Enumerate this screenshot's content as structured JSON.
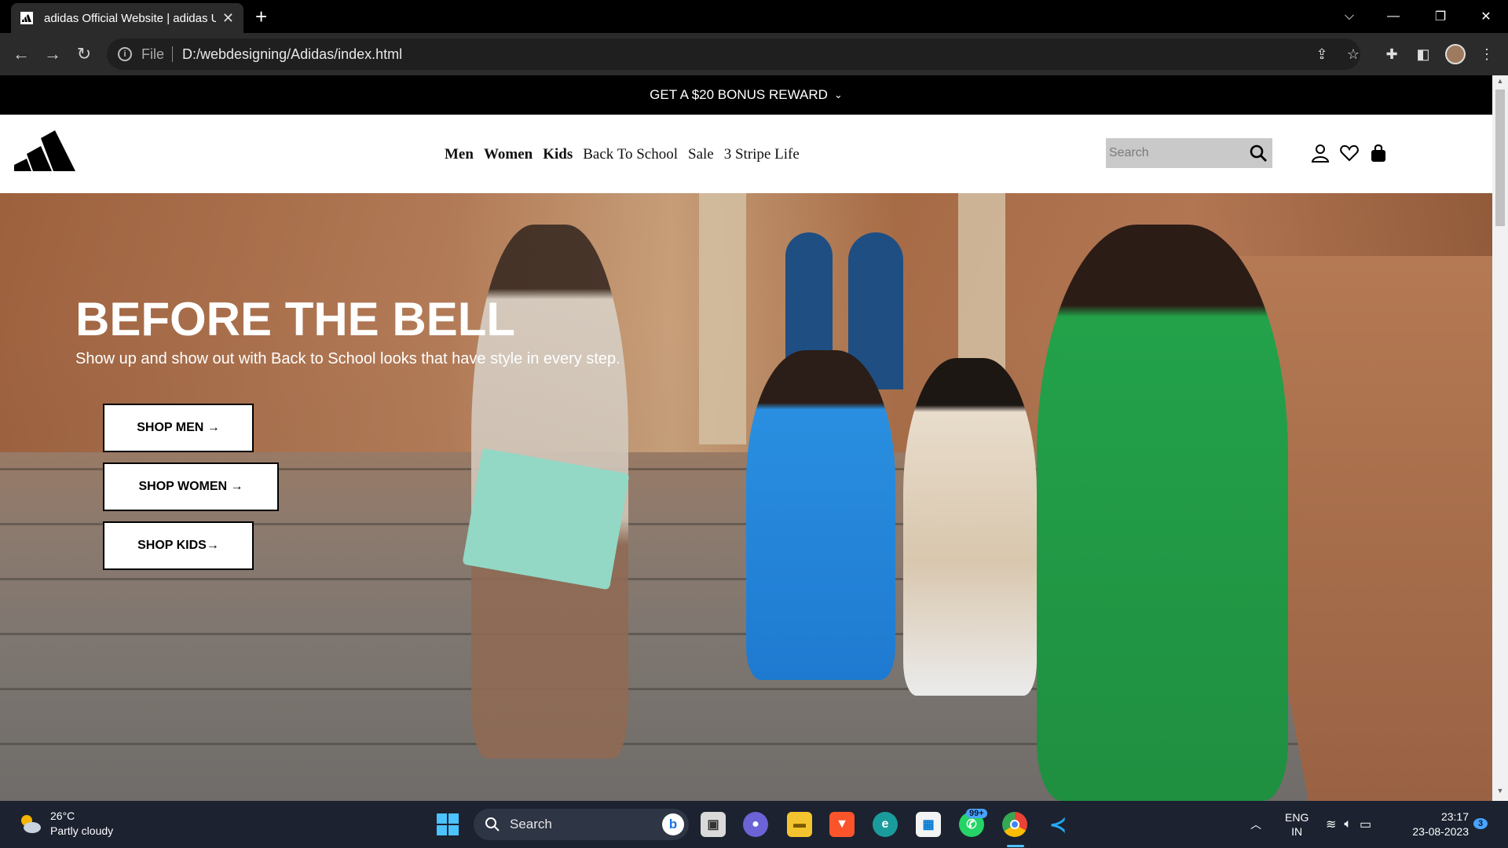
{
  "browser": {
    "tab_title": "adidas Official Website | adidas U",
    "tab_close": "✕",
    "new_tab": "+",
    "url_scheme": "File",
    "url": "D:/webdesigning/Adidas/index.html"
  },
  "promo": {
    "text": "GET A $20 BONUS REWARD"
  },
  "nav": {
    "men": "Men",
    "women": "Women",
    "kids": "Kids",
    "back_to_school": "Back To School",
    "sale": "Sale",
    "three_stripe": "3 Stripe Life"
  },
  "search": {
    "placeholder": "Search"
  },
  "hero": {
    "title": "BEFORE THE BELL",
    "subtitle": "Show up and show out with Back to School looks that have style in every step.",
    "buttons": {
      "men": "SHOP MEN →",
      "women": "SHOP WOMEN →",
      "kids": "SHOP KIDS→"
    }
  },
  "taskbar": {
    "temperature": "26°C",
    "condition": "Partly cloudy",
    "search_label": "Search",
    "whatsapp_badge": "99+",
    "lang_top": "ENG",
    "lang_bottom": "IN",
    "time": "23:17",
    "date": "23-08-2023",
    "notif_count": "3"
  },
  "colors": {
    "promo_bg": "#000000",
    "search_bg": "#c9c9c9",
    "taskbar_bg": "#1c2230"
  }
}
